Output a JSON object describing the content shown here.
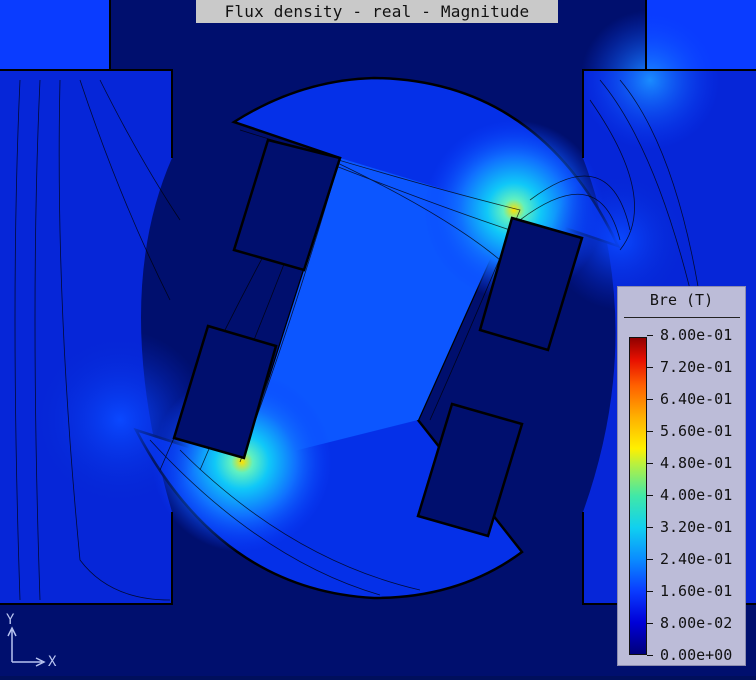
{
  "plot": {
    "title": "Flux density - real - Magnitude",
    "background_color": "#000f5c",
    "field_colors": {
      "low": "#000f6e",
      "mid": "#0a3cff",
      "high": "#10d0f0",
      "peak": "#ffe000"
    }
  },
  "legend": {
    "title": "Bre (T)",
    "ticks": [
      "8.00e-01",
      "7.20e-01",
      "6.40e-01",
      "5.60e-01",
      "4.80e-01",
      "4.00e-01",
      "3.20e-01",
      "2.40e-01",
      "1.60e-01",
      "8.00e-02",
      "0.00e+00"
    ],
    "range": [
      0.0,
      0.8
    ]
  },
  "axes": {
    "x_label": "X",
    "y_label": "Y"
  }
}
